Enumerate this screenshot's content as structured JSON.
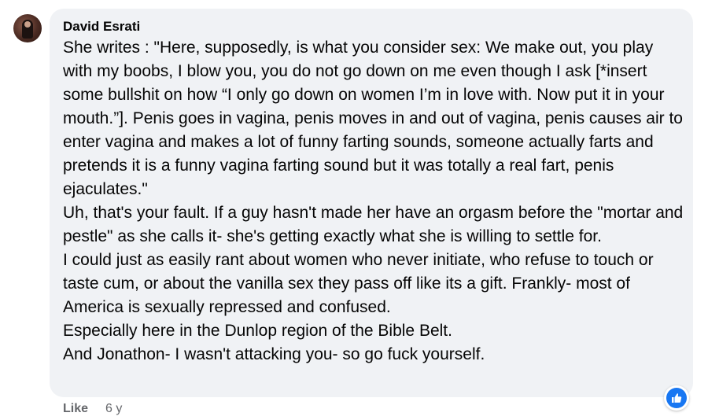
{
  "comment": {
    "author": "David Esrati",
    "paragraphs": [
      "She writes : \"Here, supposedly, is what you consider sex: We make out, you play with my boobs, I blow you, you do not go down on me even though I ask [*insert some bullshit on how “I only go down on women I’m in love with. Now put it in your mouth.”]. Penis goes in vagina, penis moves in and out of vagina, penis causes air to enter vagina and makes a lot of funny farting sounds, someone actually farts and pretends it is a funny vagina farting sound but it was totally a real fart, penis ejaculates.\"",
      "Uh, that's your fault. If a guy hasn't made her have an orgasm before the \"mortar and pestle\" as she calls it- she's getting exactly what she is willing to settle for.",
      "I could just as easily rant about women who never initiate, who refuse to touch or taste cum, or about the vanilla sex they pass off like its a gift. Frankly- most of America is sexually repressed and confused.",
      "Especially here in the Dunlop region of the Bible Belt.",
      "And Jonathon- I wasn't attacking you- so go fuck yourself."
    ],
    "actions": {
      "like_label": "Like",
      "timestamp": "6 y"
    },
    "reaction_icon": "thumbs-up-icon",
    "colors": {
      "bubble": "#f0f2f5",
      "reaction": "#1877f2",
      "meta_text": "#65676b"
    }
  }
}
